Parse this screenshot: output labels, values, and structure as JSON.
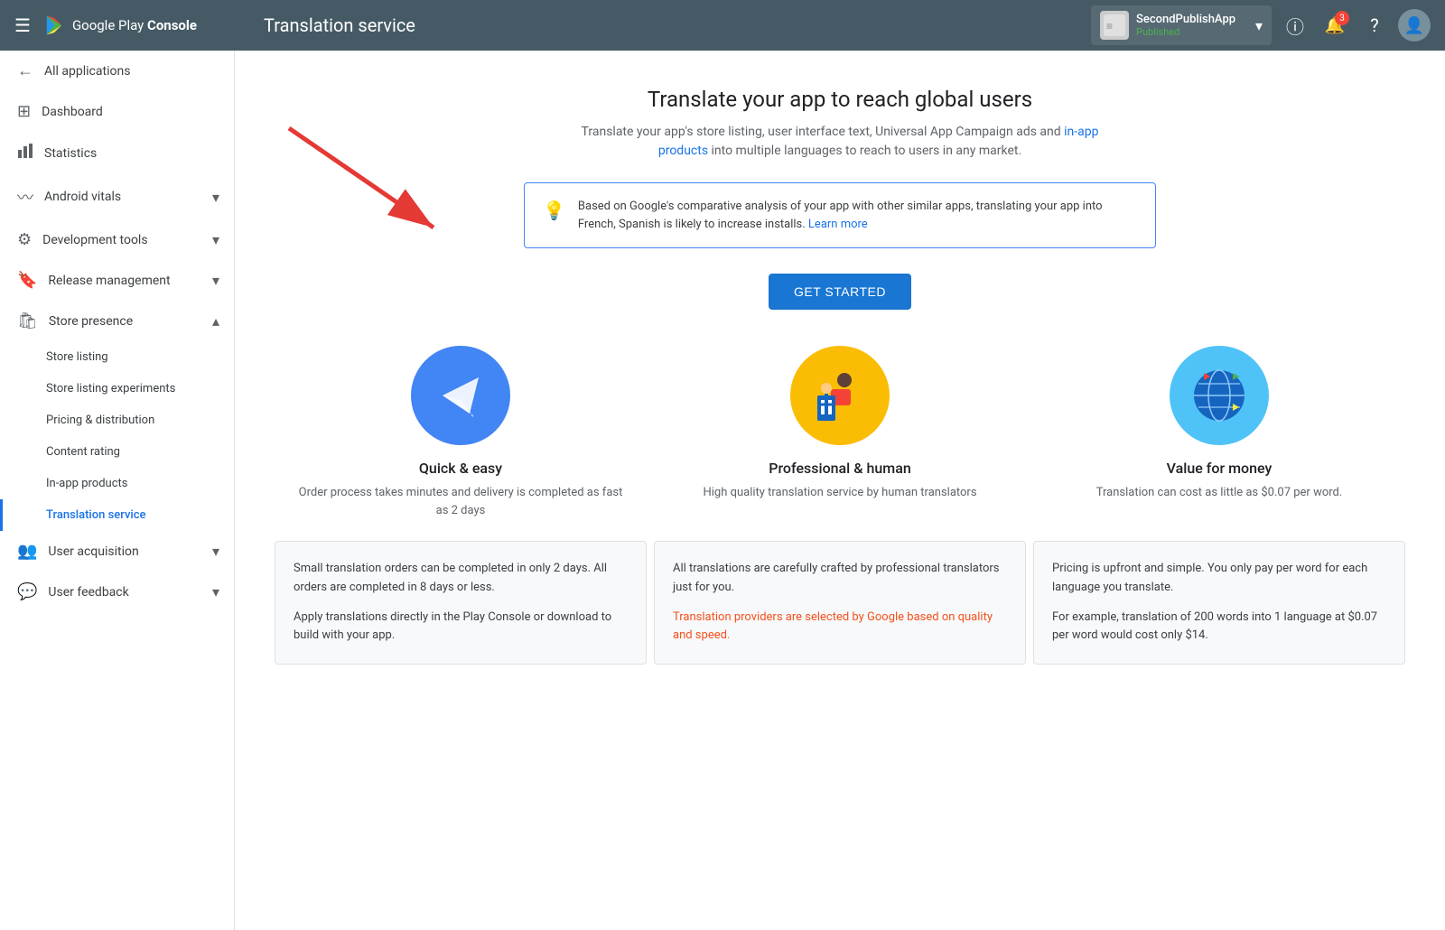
{
  "topbar": {
    "menu_icon": "☰",
    "logo_text_plain": "Google Play",
    "logo_text_bold": "Console",
    "page_title": "Translation service",
    "app_name": "SecondPublishApp",
    "app_status": "Published",
    "notification_count": "3"
  },
  "sidebar": {
    "back_label": "All applications",
    "items": [
      {
        "id": "dashboard",
        "label": "Dashboard",
        "icon": "⊞",
        "has_chevron": false
      },
      {
        "id": "statistics",
        "label": "Statistics",
        "icon": "📊",
        "has_chevron": false
      },
      {
        "id": "android-vitals",
        "label": "Android vitals",
        "icon": "〰",
        "has_chevron": true
      },
      {
        "id": "development-tools",
        "label": "Development tools",
        "icon": "🔧",
        "has_chevron": true
      },
      {
        "id": "release-management",
        "label": "Release management",
        "icon": "🔖",
        "has_chevron": true
      },
      {
        "id": "store-presence",
        "label": "Store presence",
        "icon": "🛍",
        "has_chevron": true,
        "expanded": true
      }
    ],
    "sub_items": [
      {
        "id": "store-listing",
        "label": "Store listing",
        "active": false
      },
      {
        "id": "store-listing-experiments",
        "label": "Store listing experiments",
        "active": false
      },
      {
        "id": "pricing-distribution",
        "label": "Pricing & distribution",
        "active": false
      },
      {
        "id": "content-rating",
        "label": "Content rating",
        "active": false
      },
      {
        "id": "in-app-products",
        "label": "In-app products",
        "active": false
      },
      {
        "id": "translation-service",
        "label": "Translation service",
        "active": true
      }
    ],
    "bottom_items": [
      {
        "id": "user-acquisition",
        "label": "User acquisition",
        "icon": "👥",
        "has_chevron": true
      },
      {
        "id": "user-feedback",
        "label": "User feedback",
        "icon": "💬",
        "has_chevron": true
      }
    ]
  },
  "main": {
    "hero_title": "Translate your app to reach global users",
    "hero_description": "Translate your app's store listing, user interface text, Universal App Campaign ads and in-app products into multiple languages to reach to users in any market.",
    "info_text": "Based on Google's comparative analysis of your app with other similar apps, translating your app into French, Spanish is likely to increase installs.",
    "info_link": "Learn more",
    "get_started_label": "GET STARTED",
    "features": [
      {
        "id": "quick-easy",
        "title": "Quick & easy",
        "description": "Order process takes minutes and delivery is completed as fast as 2 days",
        "circle_color": "#4285f4"
      },
      {
        "id": "professional-human",
        "title": "Professional & human",
        "description": "High quality translation service by human translators",
        "circle_color": "#fbbc04"
      },
      {
        "id": "value-money",
        "title": "Value for money",
        "description": "Translation can cost as little as $0.07 per word.",
        "circle_color": "#4fc3f7"
      }
    ],
    "detail_cards": [
      {
        "id": "quick-detail",
        "paragraphs": [
          "Small translation orders can be completed in only 2 days. All orders are completed in 8 days or less.",
          "Apply translations directly in the Play Console or download to build with your app."
        ],
        "highlight": ""
      },
      {
        "id": "professional-detail",
        "paragraphs": [
          "All translations are carefully crafted by professional translators just for you.",
          "Translation providers are selected by Google based on quality and speed."
        ],
        "highlight": "Translation providers are selected by Google based on quality and speed."
      },
      {
        "id": "value-detail",
        "paragraphs": [
          "Pricing is upfront and simple. You only pay per word for each language you translate.",
          "For example, translation of 200 words into 1 language at $0.07 per word would cost only $14."
        ],
        "highlight": ""
      }
    ]
  }
}
